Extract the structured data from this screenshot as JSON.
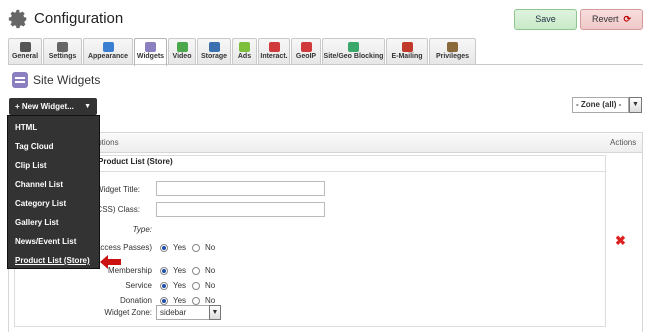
{
  "header": {
    "title": "Configuration",
    "save_label": "Save",
    "revert_label": "Revert",
    "revert_icon": "refresh-icon"
  },
  "tabs": [
    {
      "label": "General",
      "icon": "video-icon",
      "color": "#555555"
    },
    {
      "label": "Settings",
      "icon": "gears-icon",
      "color": "#666666"
    },
    {
      "label": "Appearance",
      "icon": "brush-icon",
      "color": "#3a7fd0"
    },
    {
      "label": "Widgets",
      "icon": "widgets-icon",
      "color": "#8c7fbf",
      "active": true
    },
    {
      "label": "Video",
      "icon": "film-icon",
      "color": "#4aa84a"
    },
    {
      "label": "Storage",
      "icon": "storage-icon",
      "color": "#3a6fb0"
    },
    {
      "label": "Ads",
      "icon": "ads-icon",
      "color": "#7bbf3a"
    },
    {
      "label": "Interact.",
      "icon": "cursor-icon",
      "color": "#d03a3a"
    },
    {
      "label": "GeoIP",
      "icon": "map-pin-icon",
      "color": "#d03a3a"
    },
    {
      "label": "Site/Geo Blocking",
      "icon": "globe-icon",
      "color": "#3aa86a"
    },
    {
      "label": "E-Mailing",
      "icon": "mail-icon",
      "color": "#c0392b"
    },
    {
      "label": "Privileges",
      "icon": "users-icon",
      "color": "#8a6a3a"
    }
  ],
  "section": {
    "title": "Site Widgets",
    "new_widget_label": "+ New Widget...",
    "zone_filter": "- Zone (all) -"
  },
  "table": {
    "col_options": "Options",
    "col_actions": "Actions",
    "row_title": "Product List (Store)"
  },
  "form": {
    "widget_title_label": "Widget Title:",
    "container_class_label": "Container (CSS) Class:",
    "type_label": "Type:",
    "type_options": [
      {
        "label": "Credit + WebTV Access Passes)",
        "value": "Yes"
      },
      {
        "label": "Membership",
        "value": "Yes"
      },
      {
        "label": "Service",
        "value": "Yes"
      },
      {
        "label": "Donation",
        "value": "Yes"
      }
    ],
    "yes_label": "Yes",
    "no_label": "No",
    "widget_zone_label": "Widget Zone:",
    "widget_zone_value": "sidebar"
  },
  "menu": {
    "items": [
      "HTML",
      "Tag Cloud",
      "Clip List",
      "Channel List",
      "Category List",
      "Gallery List",
      "News/Event List",
      "Product List (Store)"
    ],
    "highlighted": "Product List (Store)"
  },
  "colors": {
    "accent": "#8c7fbf",
    "menu_bg": "#333333",
    "delete": "#dd2222",
    "arrow": "#cc1111"
  }
}
